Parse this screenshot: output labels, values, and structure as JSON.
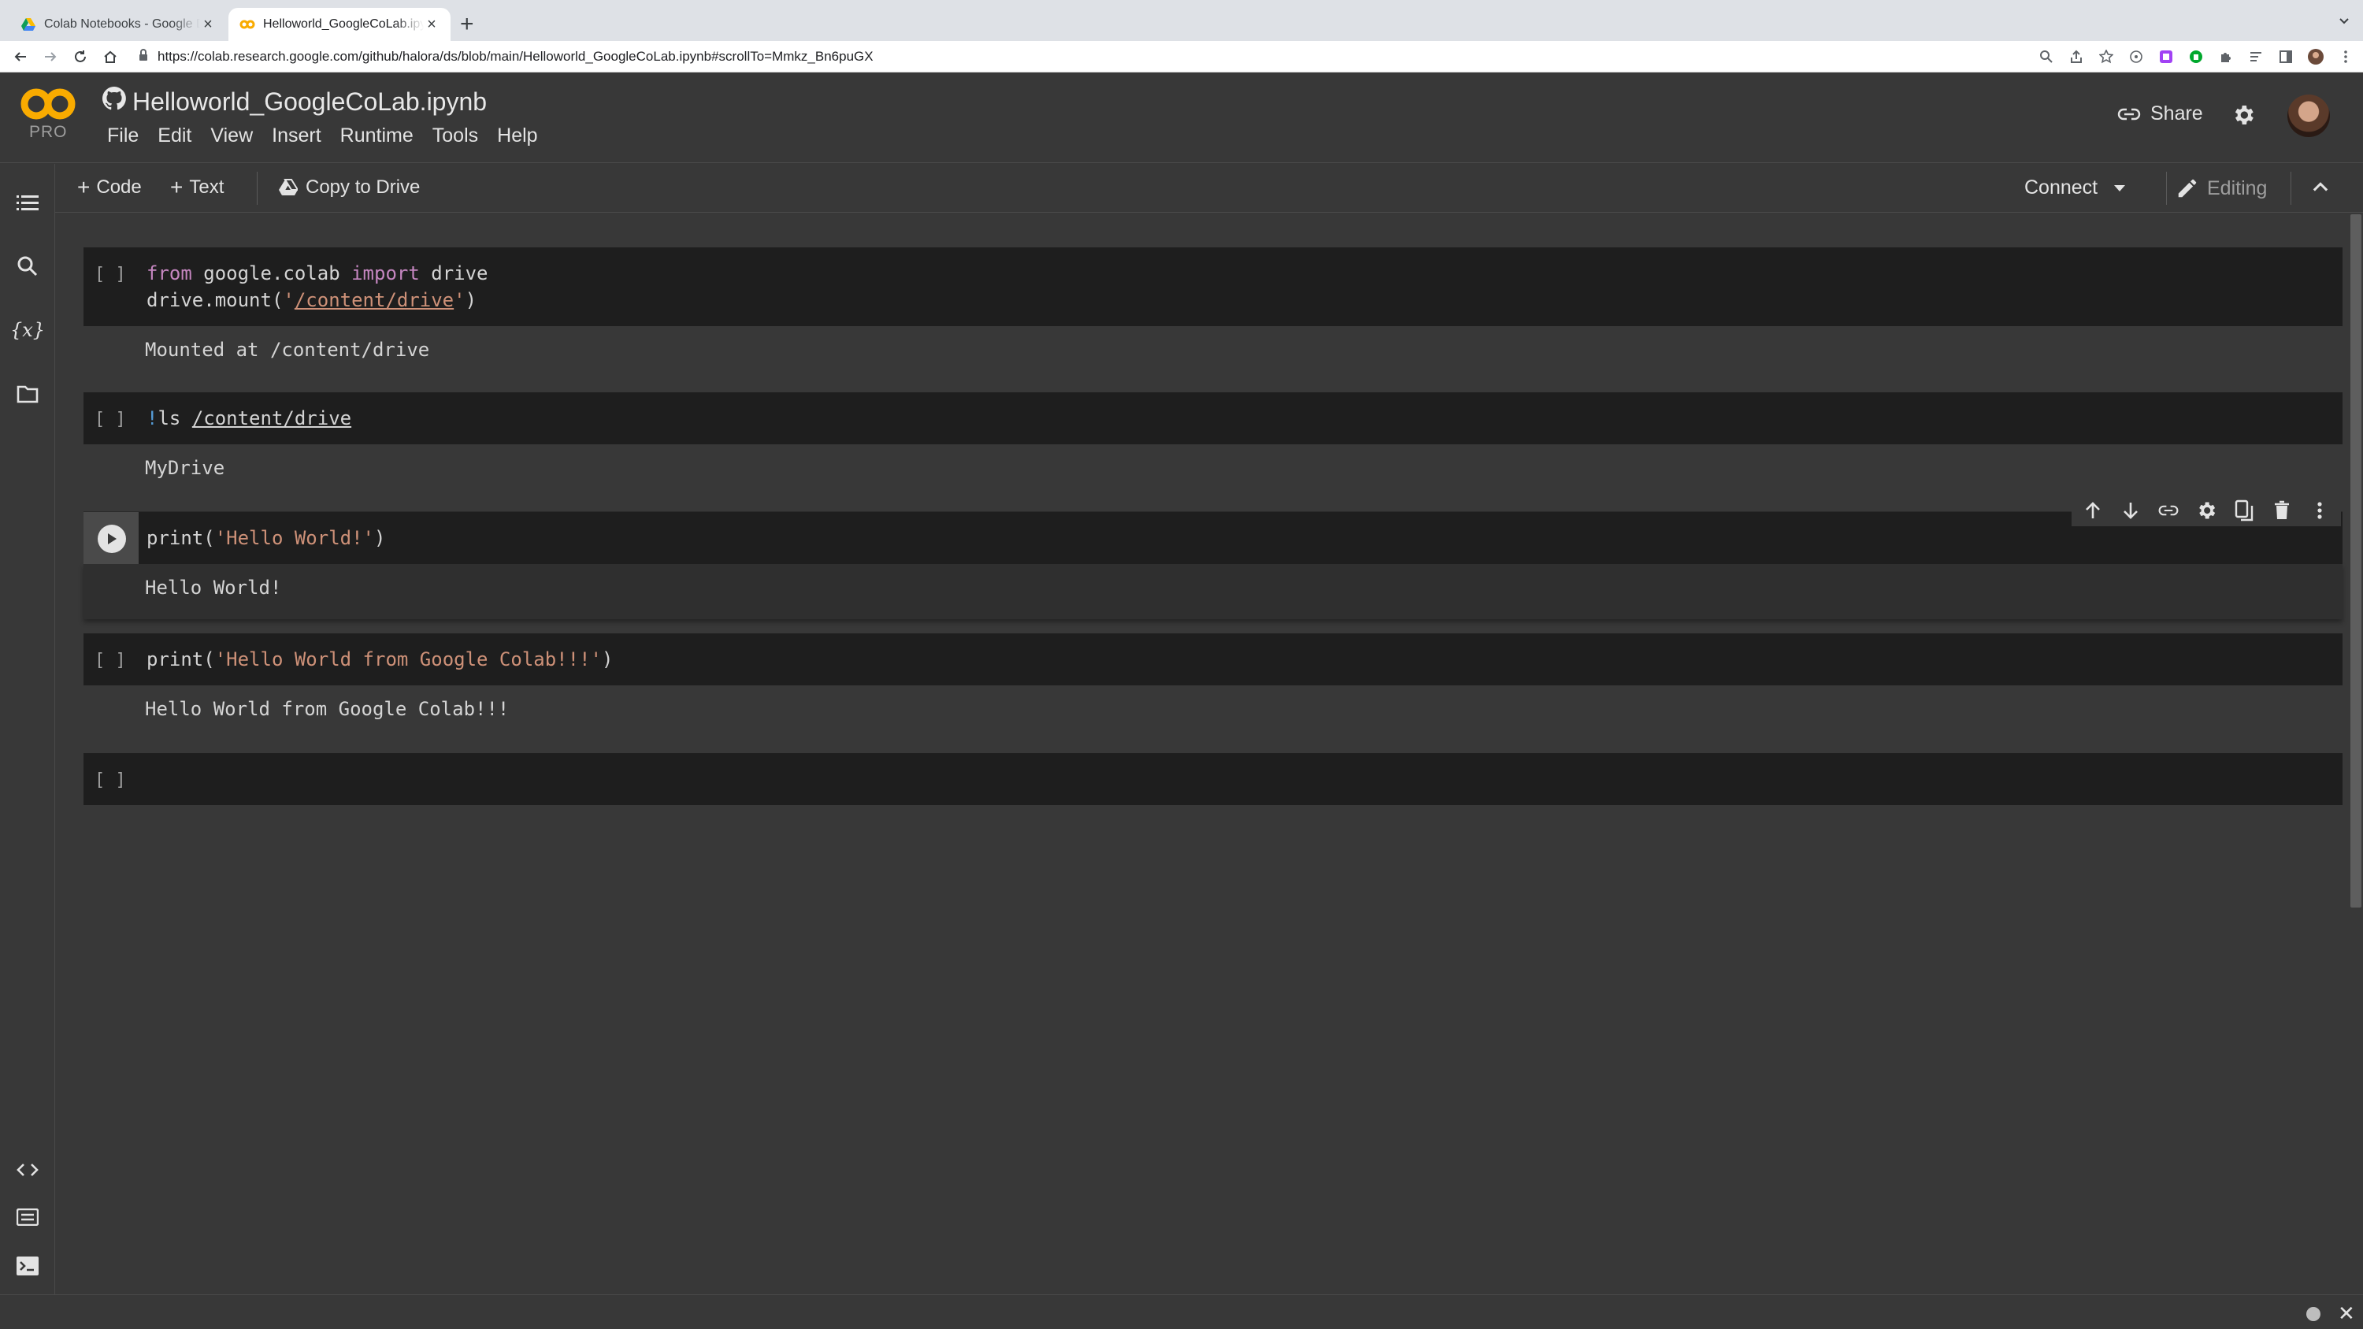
{
  "browser": {
    "tabs": [
      {
        "title": "Colab Notebooks - Google Drive",
        "active": false
      },
      {
        "title": "Helloworld_GoogleCoLab.ipynb",
        "active": true
      }
    ],
    "url": "https://colab.research.google.com/github/halora/ds/blob/main/Helloworld_GoogleCoLab.ipynb#scrollTo=Mmkz_Bn6puGX"
  },
  "header": {
    "logo_text": "CO",
    "badge": "PRO",
    "title": "Helloworld_GoogleCoLab.ipynb",
    "menu": [
      "File",
      "Edit",
      "View",
      "Insert",
      "Runtime",
      "Tools",
      "Help"
    ],
    "share_label": "Share"
  },
  "toolbar": {
    "add_code": "Code",
    "add_text": "Text",
    "copy_to_drive": "Copy to Drive",
    "connect": "Connect",
    "editing": "Editing"
  },
  "cells": {
    "c1": {
      "bracket": "[ ]",
      "l1_kw1": "from",
      "l1_mid": " google.colab ",
      "l1_kw2": "import",
      "l1_end": " drive",
      "l2_pre": "drive.mount(",
      "l2_q1": "'",
      "l2_path": "/content/drive",
      "l2_q2": "'",
      "l2_end": ")",
      "output": "Mounted at /content/drive"
    },
    "c2": {
      "bracket": "[ ]",
      "bang": "!",
      "cmd": "ls ",
      "path": "/content/drive",
      "output": "MyDrive"
    },
    "c3": {
      "pre": "print(",
      "str": "'Hello World!'",
      "end": ")",
      "output": "Hello World!"
    },
    "c4": {
      "bracket": "[ ]",
      "pre": "print(",
      "str": "'Hello World from Google Colab!!!'",
      "end": ")",
      "output": "Hello World from Google Colab!!!"
    },
    "c5": {
      "bracket": "[ ]"
    }
  },
  "colors": {
    "background": "#383838",
    "code_bg": "#1e1e1e",
    "keyword": "#c586c0",
    "string": "#ce9178",
    "logo_orange": "#f9ab00"
  }
}
